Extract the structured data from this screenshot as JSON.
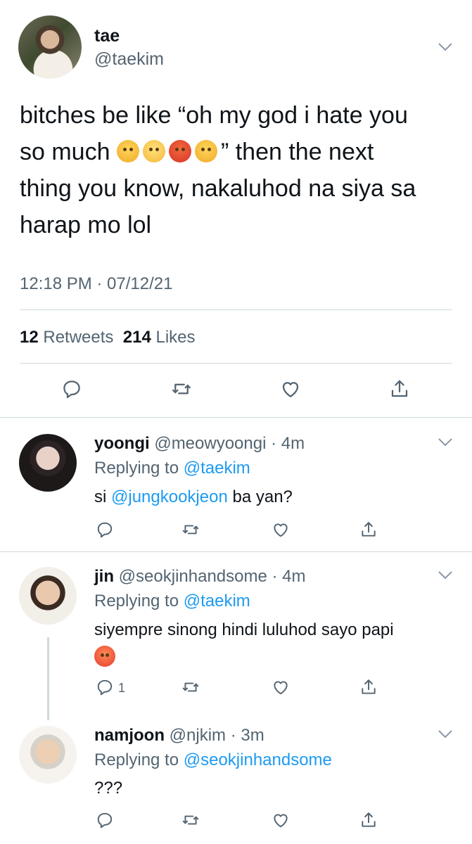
{
  "tweet": {
    "name": "tae",
    "handle": "@taekim",
    "text_line1": "bitches be like “oh my god i hate you",
    "text_line2_start": "so much ",
    "text_line2_end": "” then the next",
    "text_line3": "thing you know, nakaluhod na siya sa",
    "text_line4": "harap mo lol",
    "emojis": [
      "angry-face",
      "eye-roll-face",
      "pouting-face",
      "steam-nose-face"
    ],
    "timestamp": "12:18 PM · 07/12/21",
    "retweets_count": "12",
    "retweets_label": "Retweets",
    "likes_count": "214",
    "likes_label": "Likes"
  },
  "replies": [
    {
      "name": "yoongi",
      "handle": "@meowyoongi",
      "time": "· 4m",
      "replying_prefix": "Replying to ",
      "replying_to": "@taekim",
      "text_before": "si ",
      "text_mention": "@jungkookjeon",
      "text_after": " ba yan?"
    },
    {
      "name": "jin",
      "handle": "@seokjinhandsome",
      "time": "· 4m",
      "replying_prefix": "Replying to ",
      "replying_to": "@taekim",
      "text": "siyempre sinong hindi luluhod sayo papi",
      "emoji": "hot-face",
      "reply_count": "1"
    },
    {
      "name": "namjoon",
      "handle": "@njkim",
      "time": "· 3m",
      "replying_prefix": "Replying to ",
      "replying_to": "@seokjinhandsome",
      "text": "???"
    }
  ],
  "colors": {
    "text": "#0f1419",
    "secondary": "#536471",
    "link": "#1d9bf0",
    "divider": "#cfd9de"
  }
}
